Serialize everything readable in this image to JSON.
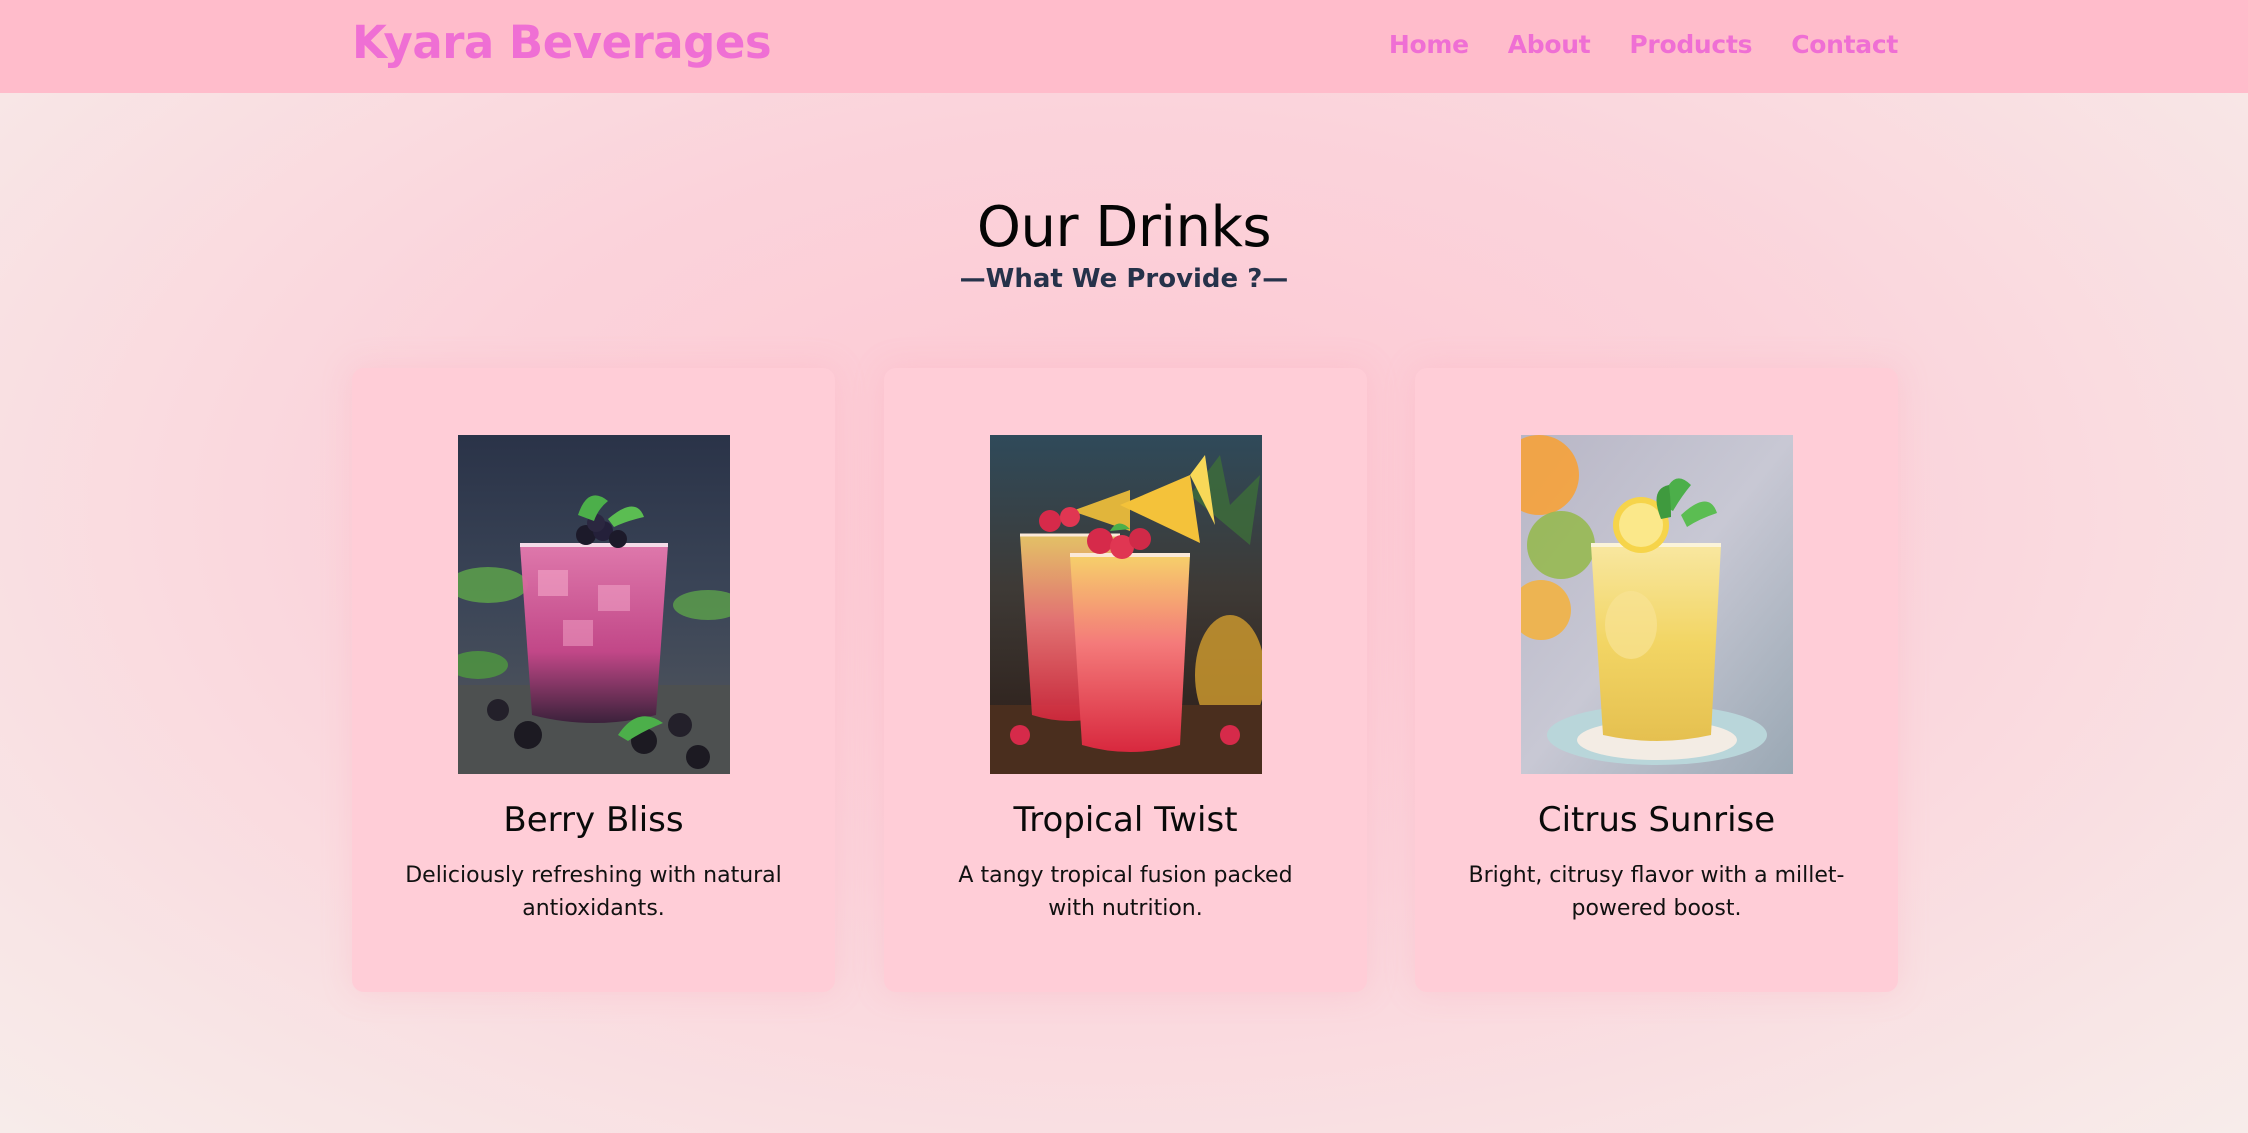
{
  "brand": "Kyara Beverages",
  "nav": [
    "Home",
    "About",
    "Products",
    "Contact"
  ],
  "section": {
    "title": "Our Drinks",
    "subtitle": "—What We Provide ?—"
  },
  "drinks": [
    {
      "name": "Berry Bliss",
      "description": "Deliciously refreshing with natural antioxidants.",
      "image": "berry-drink-photo"
    },
    {
      "name": "Tropical Twist",
      "description": "A tangy tropical fusion packed with nutrition.",
      "image": "tropical-drink-photo"
    },
    {
      "name": "Citrus Sunrise",
      "description": "Bright, citrusy flavor with a millet-powered boost.",
      "image": "citrus-drink-photo"
    }
  ],
  "colors": {
    "navbar_bg": "#ffbccb",
    "brand": "#ef6fd4",
    "card_bg": "#ffcdd7",
    "subtitle": "#26324a"
  }
}
